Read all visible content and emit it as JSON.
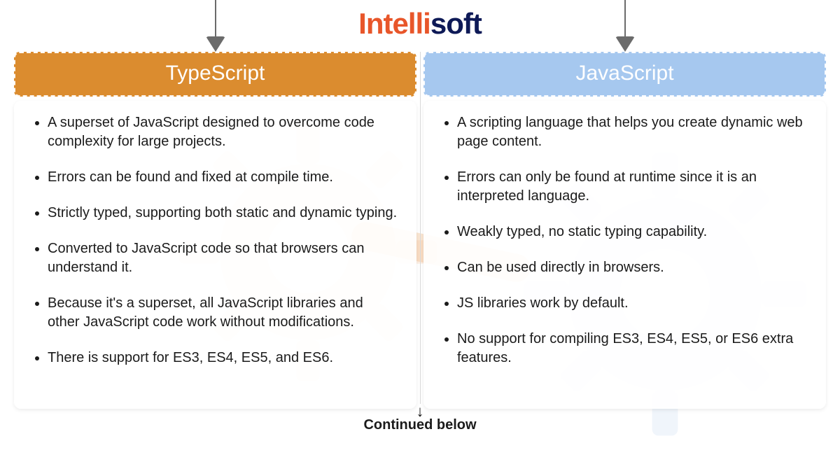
{
  "brand": {
    "part1": "Intelli",
    "part2": "soft"
  },
  "columns": {
    "left": {
      "title": "TypeScript",
      "header_color": "#db8c2f",
      "items": [
        "A superset of JavaScript designed to overcome code complexity for large projects.",
        "Errors can be found and fixed at compile time.",
        "Strictly typed, supporting both static and dynamic typing.",
        "Converted to JavaScript code so that browsers can understand it.",
        "Because it's a superset, all JavaScript libraries and other JavaScript code work without modifications.",
        "There is support for ES3, ES4, ES5, and ES6."
      ]
    },
    "right": {
      "title": "JavaScript",
      "header_color": "#a6c8ef",
      "items": [
        "A scripting language that helps you create dynamic web page content.",
        "Errors can only be found at runtime since it is an interpreted language.",
        "Weakly typed, no static typing capability.",
        "Can be used directly in browsers.",
        "JS libraries work by default.",
        "No support for compiling ES3, ES4, ES5, or ES6 extra features."
      ]
    }
  },
  "footer": {
    "arrow": "↓",
    "text": "Continued below"
  }
}
